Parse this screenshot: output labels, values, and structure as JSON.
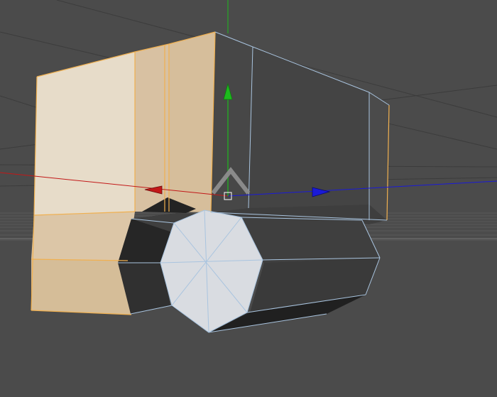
{
  "viewport": {
    "background_color": "#4b4b4b",
    "floor_grid_color": "#5a5a5a",
    "horizon_color": "#555555"
  },
  "axes": {
    "x_color": "#c21818",
    "y_color": "#1dbb1d",
    "z_color": "#1a1ad8"
  },
  "object": {
    "selected_face_color": "#e6dbc8",
    "selected_edge_color": "#f0b050",
    "unselected_face_color": "#4a4a4a",
    "unselected_edge_color": "#a9c4df",
    "cylinder_cap_color": "#d8dbe0"
  },
  "gizmo": {
    "move_icon": "move-gizmo-icon",
    "center_handle_icon": "center-handle-icon"
  }
}
